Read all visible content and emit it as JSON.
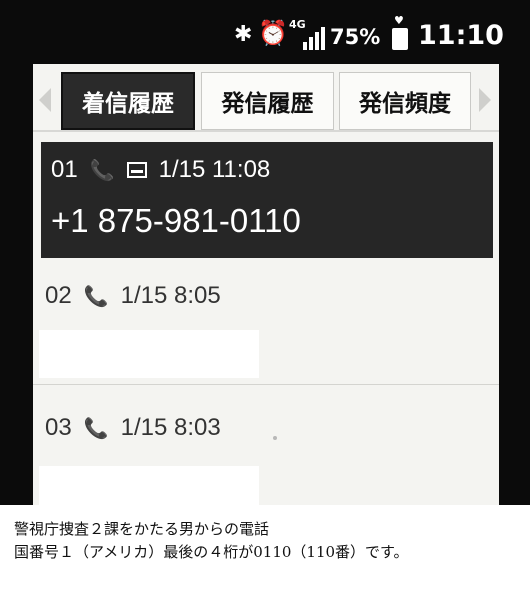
{
  "status_bar": {
    "bluetooth_icon": "bluetooth-icon",
    "alarm_icon": "alarm-icon",
    "network": "4G",
    "battery_percent": "75%",
    "time": "11:10"
  },
  "tabs": [
    {
      "label": "着信履歴",
      "active": true
    },
    {
      "label": "発信履歴",
      "active": false
    },
    {
      "label": "発信頻度",
      "active": false
    }
  ],
  "calls": [
    {
      "index": "01",
      "datetime": "1/15 11:08",
      "number": "+1 875-981-0110",
      "icons": [
        "incoming-call-icon",
        "contact-card-icon"
      ]
    },
    {
      "index": "02",
      "datetime": "1/15 8:05",
      "number": "",
      "icons": [
        "incoming-call-icon"
      ]
    },
    {
      "index": "03",
      "datetime": "1/15 8:03",
      "number": "",
      "icons": [
        "incoming-call-icon"
      ]
    }
  ],
  "caption": {
    "line1": "警視庁捜査２課をかたる男からの電話",
    "line2": "国番号１（アメリカ）最後の４桁が0110（110番）です。"
  }
}
